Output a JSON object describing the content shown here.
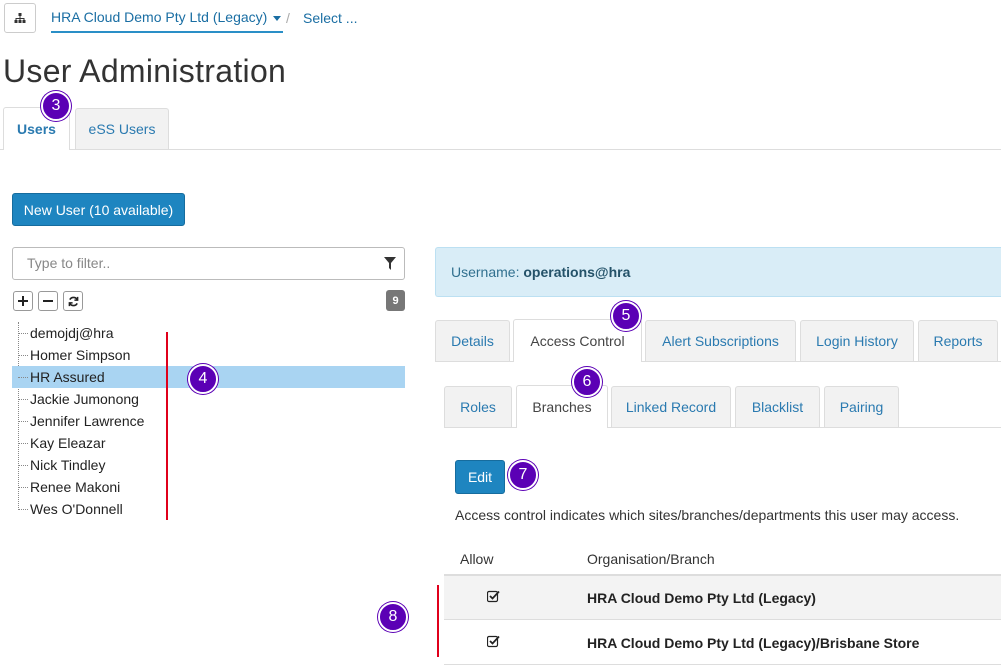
{
  "breadcrumb": {
    "org": "HRA Cloud Demo Pty Ltd (Legacy)",
    "separator": "/",
    "select": "Select ..."
  },
  "page_title": "User Administration",
  "main_tabs": [
    {
      "label": "Users",
      "active": true
    },
    {
      "label": "eSS Users",
      "active": false
    }
  ],
  "new_user_label": "New User (10 available)",
  "filter": {
    "placeholder": "Type to filter..",
    "value": ""
  },
  "user_count": "9",
  "users": [
    "demojdj@hra",
    "Homer Simpson",
    "HR Assured",
    "Jackie Jumonong",
    "Jennifer Lawrence",
    "Kay Eleazar",
    "Nick Tindley",
    "Renee Makoni",
    "Wes O'Donnell"
  ],
  "selected_user": "HR Assured",
  "username": {
    "label": "Username:",
    "value": "operations@hra"
  },
  "detail_tabs": [
    {
      "label": "Details",
      "active": false
    },
    {
      "label": "Access Control",
      "active": true
    },
    {
      "label": "Alert Subscriptions",
      "active": false
    },
    {
      "label": "Login History",
      "active": false
    },
    {
      "label": "Reports",
      "active": false
    }
  ],
  "access_tabs": [
    {
      "label": "Roles",
      "active": false
    },
    {
      "label": "Branches",
      "active": true
    },
    {
      "label": "Linked Record",
      "active": false
    },
    {
      "label": "Blacklist",
      "active": false
    },
    {
      "label": "Pairing",
      "active": false
    }
  ],
  "edit_label": "Edit",
  "access_description": "Access control indicates which sites/branches/departments this user may access.",
  "table": {
    "headers": {
      "allow": "Allow",
      "org": "Organisation/Branch"
    },
    "rows": [
      {
        "allowed": true,
        "org": "HRA Cloud Demo Pty Ltd (Legacy)"
      },
      {
        "allowed": true,
        "org": "HRA Cloud Demo Pty Ltd (Legacy)/Brisbane Store"
      }
    ]
  },
  "markers": [
    "3",
    "4",
    "5",
    "6",
    "7",
    "8"
  ],
  "colors": {
    "primary": "#1e85c0",
    "link": "#2a7ab0",
    "selected_row": "#a9d4f2",
    "info_bg": "#d9edf7",
    "marker": "#5b00b5",
    "annotation_line": "#e0001b"
  }
}
